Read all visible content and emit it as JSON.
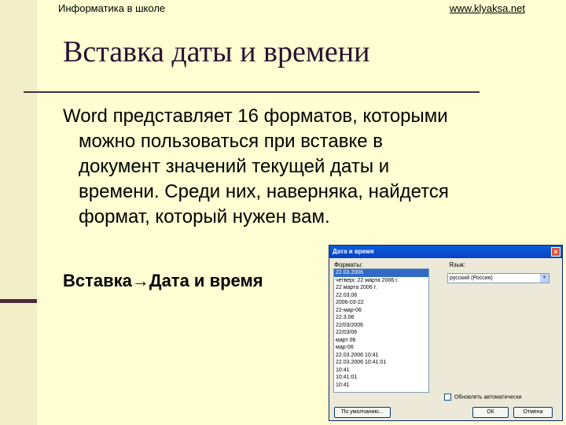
{
  "header": {
    "left": "Информатика в школе",
    "right": "www.klyaksa.net"
  },
  "slide": {
    "title": "Вставка даты и времени",
    "body_lines": [
      "Word представляет 16 форматов, которыми",
      "можно пользоваться при вставке в",
      "документ значений текущей даты и",
      "времени. Среди них, наверняка, найдется",
      "формат, который нужен вам."
    ],
    "menu_path": "Вставка→Дата и время"
  },
  "dialog": {
    "title": "Дата и время",
    "close": "×",
    "formats_label": "Форматы:",
    "language_label": "Язык:",
    "language_value": "русский (Россия)",
    "formats": [
      "22.03.2006",
      "четверг, 22 марта 2006 г.",
      "22 марта 2006 г.",
      "22.03.06",
      "2006-03-22",
      "22-мар-06",
      "22.3.06",
      "22/03/2006",
      "22/03/06",
      "март 06",
      "мар-06",
      "22.03.2006 10:41",
      "22.03.2006 10:41:01",
      "10:41",
      "10:41:01",
      "10:41"
    ],
    "auto_update_label": "Обновлять автоматически",
    "default_button": "По умолчанию...",
    "ok_button": "ОК",
    "cancel_button": "Отмена"
  }
}
